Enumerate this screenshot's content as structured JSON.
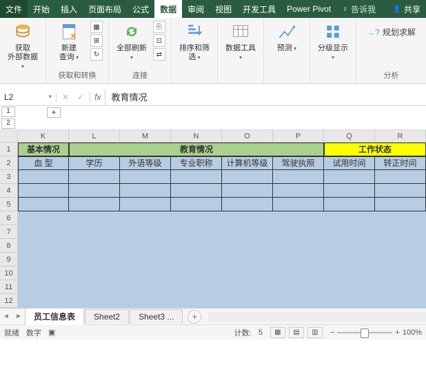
{
  "tabs": {
    "file": "文件",
    "home": "开始",
    "insert": "插入",
    "layout": "页面布局",
    "formula": "公式",
    "data": "数据",
    "review": "审阅",
    "view": "视图",
    "dev": "开发工具",
    "power": "Power Pivot",
    "tellme": "告诉我",
    "share": "共享"
  },
  "ribbon": {
    "getdata": "获取\n外部数据",
    "newquery": "新建\n查询",
    "group1": "获取和转换",
    "refresh": "全部刷新",
    "group2": "连接",
    "sortfilter": "排序和筛选",
    "datatools": "数据工具",
    "forecast": "预测",
    "subtotal": "分级显示",
    "solver": "规划求解",
    "group6": "分析"
  },
  "namebox": "L2",
  "formula_bar": "教育情况",
  "outline_levels": [
    "1",
    "2"
  ],
  "outline_expand": "+",
  "columns": [
    "K",
    "L",
    "M",
    "N",
    "O",
    "P",
    "Q",
    "R"
  ],
  "row_numbers": [
    "1",
    "2",
    "3",
    "4",
    "5",
    "6",
    "7",
    "8",
    "9",
    "10",
    "11",
    "12"
  ],
  "merged": {
    "basic": "基本情况",
    "edu": "教育情况",
    "work": "工作状态"
  },
  "headers2": [
    "血  型",
    "学历",
    "外语等级",
    "专业职称",
    "计算机等级",
    "驾驶执照",
    "试用时间",
    "转正时间"
  ],
  "sheets": {
    "active": "员工信息表",
    "s2": "Sheet2",
    "s3": "Sheet3 ..."
  },
  "status": {
    "mode": "就绪",
    "extra": "数字",
    "count_label": "计数:",
    "count_value": "5",
    "zoom": "100%"
  }
}
